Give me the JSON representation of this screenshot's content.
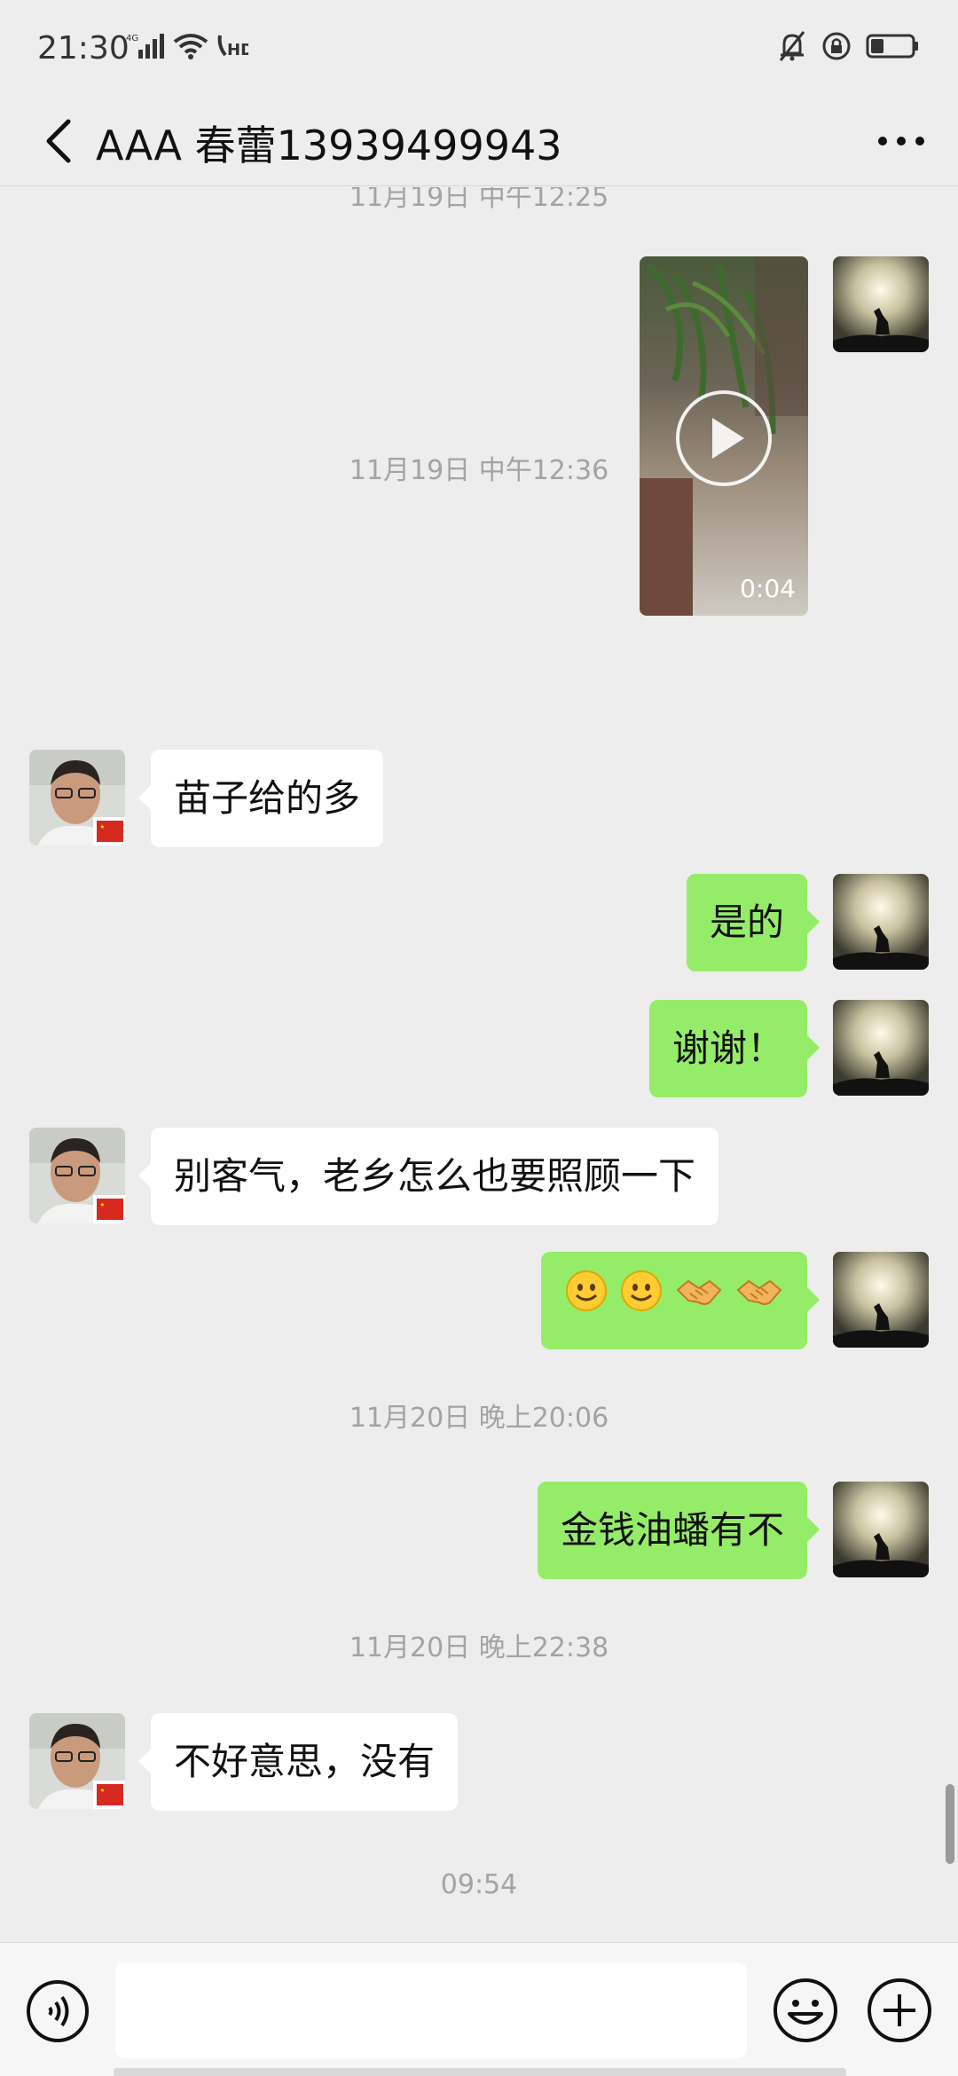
{
  "status_bar": {
    "time": "21:30",
    "network": "4G",
    "hd": "HD",
    "icons": [
      "signal-icon",
      "wifi-icon",
      "hd-call-icon",
      "mute-bell-icon",
      "rotation-lock-icon",
      "battery-icon"
    ]
  },
  "header": {
    "title": "AAA 春蕾13939499943",
    "back_icon": "chevron-left-icon",
    "more_icon": "more-dots-icon"
  },
  "messages": {
    "ts_partial": "11月19日 中午12:25",
    "video_duration": "0:04",
    "ts1": "11月19日 中午12:36",
    "m1": "苗子给的多",
    "m2": "是的",
    "m3": "谢谢！",
    "m4": "别客气，老乡怎么也要照顾一下",
    "m5_emojis": [
      "🙂",
      "🙂",
      "🤝",
      "🤝"
    ],
    "ts2": "11月20日 晚上20:06",
    "m6": "金钱油蟠有不",
    "ts3": "11月20日 晚上22:38",
    "m7": "不好意思，没有",
    "ts4": "09:54"
  },
  "input_bar": {
    "placeholder": "",
    "voice_icon": "voice-icon",
    "emoji_icon": "emoji-icon",
    "plus_icon": "plus-icon"
  },
  "colors": {
    "background": "#ededed",
    "sent_bubble": "#95ec69",
    "received_bubble": "#ffffff",
    "timestamp_text": "#a3a3a3"
  }
}
